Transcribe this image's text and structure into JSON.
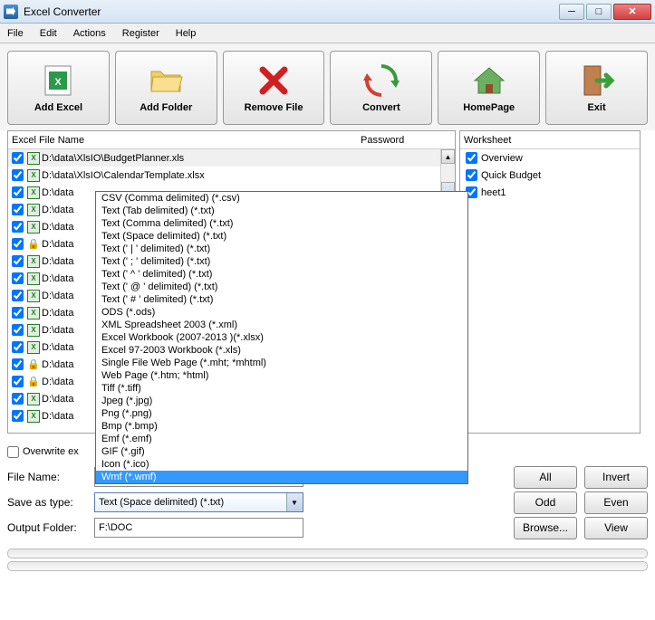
{
  "window": {
    "title": "Excel Converter"
  },
  "menu": {
    "file": "File",
    "edit": "Edit",
    "actions": "Actions",
    "register": "Register",
    "help": "Help"
  },
  "toolbar": {
    "addExcel": "Add Excel",
    "addFolder": "Add Folder",
    "removeFile": "Remove File",
    "convert": "Convert",
    "homePage": "HomePage",
    "exit": "Exit"
  },
  "columns": {
    "fileName": "Excel File Name",
    "password": "Password",
    "worksheet": "Worksheet"
  },
  "files": [
    {
      "name": "D:\\data\\XlsIO\\BudgetPlanner.xls",
      "locked": false
    },
    {
      "name": "D:\\data\\XlsIO\\CalendarTemplate.xlsx",
      "locked": false
    },
    {
      "name": "D:\\data",
      "locked": false
    },
    {
      "name": "D:\\data",
      "locked": false
    },
    {
      "name": "D:\\data",
      "locked": false
    },
    {
      "name": "D:\\data",
      "locked": true
    },
    {
      "name": "D:\\data",
      "locked": false
    },
    {
      "name": "D:\\data",
      "locked": false
    },
    {
      "name": "D:\\data",
      "locked": false
    },
    {
      "name": "D:\\data",
      "locked": false
    },
    {
      "name": "D:\\data",
      "locked": false
    },
    {
      "name": "D:\\data",
      "locked": false
    },
    {
      "name": "D:\\data",
      "locked": true
    },
    {
      "name": "D:\\data",
      "locked": true
    },
    {
      "name": "D:\\data",
      "locked": false
    },
    {
      "name": "D:\\data",
      "locked": false
    }
  ],
  "worksheets": [
    {
      "name": "Overview"
    },
    {
      "name": "Quick Budget"
    },
    {
      "name": "heet1"
    }
  ],
  "overwrite": {
    "label": "Overwrite ex"
  },
  "fields": {
    "fileNameLabel": "File Name:",
    "fileNameValue": "",
    "saveAsTypeLabel": "Save as type:",
    "saveAsTypeValue": "Text (Space delimited) (*.txt)",
    "outputFolderLabel": "Output Folder:",
    "outputFolderValue": "F:\\DOC"
  },
  "dropdown": {
    "options": [
      "CSV (Comma delimited) (*.csv)",
      "Text (Tab delimited) (*.txt)",
      "Text (Comma delimited) (*.txt)",
      "Text (Space delimited) (*.txt)",
      "Text (' | ' delimited) (*.txt)",
      "Text (' ; ' delimited) (*.txt)",
      "Text (' ^ ' delimited) (*.txt)",
      "Text (' @ ' delimited) (*.txt)",
      "Text (' # ' delimited) (*.txt)",
      "ODS (*.ods)",
      "XML Spreadsheet 2003 (*.xml)",
      "Excel Workbook (2007-2013 )(*.xlsx)",
      "Excel 97-2003 Workbook (*.xls)",
      "Single File Web Page (*.mht; *mhtml)",
      "Web Page (*.htm; *html)",
      "Tiff (*.tiff)",
      "Jpeg (*.jpg)",
      "Png (*.png)",
      "Bmp (*.bmp)",
      "Emf (*.emf)",
      "GIF (*.gif)",
      "Icon (*.ico)",
      "Wmf (*.wmf)"
    ],
    "highlightedIndex": 22
  },
  "buttons": {
    "all": "All",
    "invert": "Invert",
    "odd": "Odd",
    "even": "Even",
    "browse": "Browse...",
    "view": "View"
  }
}
